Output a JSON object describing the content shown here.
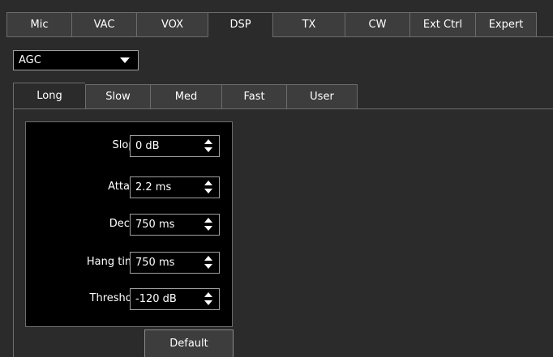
{
  "top_tabs": [
    {
      "label": "Mic"
    },
    {
      "label": "VAC"
    },
    {
      "label": "VOX"
    },
    {
      "label": "DSP"
    },
    {
      "label": "TX"
    },
    {
      "label": "CW"
    },
    {
      "label": "Ext Ctrl"
    },
    {
      "label": "Expert"
    }
  ],
  "active_top_tab": "DSP",
  "mode_select": {
    "value": "AGC"
  },
  "agc_tabs": [
    {
      "label": "Long"
    },
    {
      "label": "Slow"
    },
    {
      "label": "Med"
    },
    {
      "label": "Fast"
    },
    {
      "label": "User"
    }
  ],
  "active_agc_tab": "Long",
  "settings": {
    "slope": {
      "label": "Slope:",
      "value": "0 dB"
    },
    "attack": {
      "label": "Attack:",
      "value": "2.2 ms"
    },
    "decay": {
      "label": "Decay:",
      "value": "750 ms"
    },
    "hang_time": {
      "label": "Hang time:",
      "value": "750 ms"
    },
    "threshold": {
      "label": "Threshold:",
      "value": "-120 dB"
    }
  },
  "default_button": {
    "label": "Default"
  },
  "colors": {
    "background": "#2b2b2b",
    "field_background": "#000000",
    "tab_background": "#3d3d3d",
    "text": "#ffffff",
    "border": "#6c6c6c"
  },
  "icons": {
    "combo_arrow": "chevron-down-icon",
    "spin_up": "arrow-up-icon",
    "spin_down": "arrow-down-icon"
  }
}
